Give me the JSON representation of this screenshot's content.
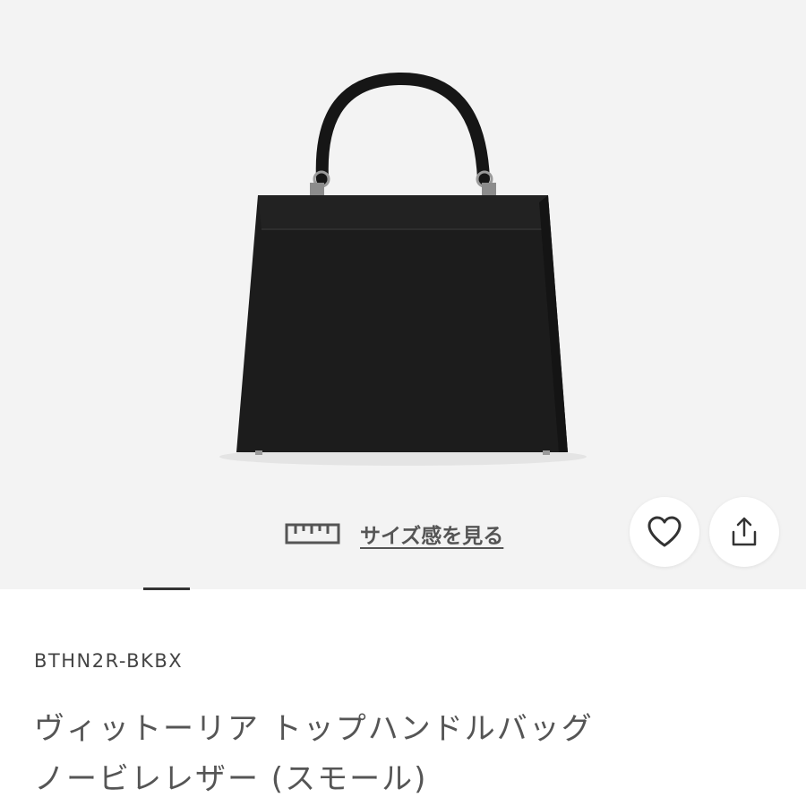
{
  "product": {
    "image_alt": "ブラックのトップハンドルバッグ",
    "size_link_label": "サイズ感を見る",
    "sku": "BTHN2R-BKBX",
    "title": "ヴィットーリア トップハンドルバッグ ノービレレザー (スモール)"
  },
  "actions": {
    "favorite_icon": "heart-icon",
    "share_icon": "share-icon",
    "size_icon": "ruler-icon"
  },
  "colors": {
    "hero_background": "#f3f3f3",
    "bag": "#1c1c1c",
    "text": "#555555"
  }
}
